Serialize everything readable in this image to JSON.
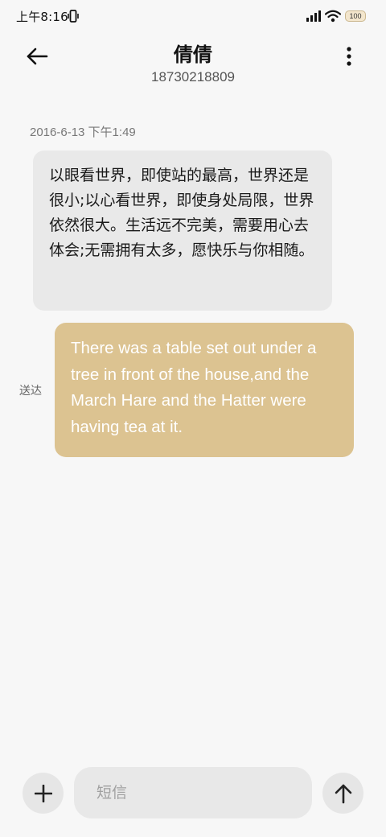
{
  "status_bar": {
    "time": "上午8:16",
    "battery": "100",
    "icons": [
      "vibrate-icon",
      "signal-icon",
      "wifi-icon",
      "battery-icon"
    ]
  },
  "header": {
    "back_icon": "arrow-left-icon",
    "contact_name": "倩倩",
    "contact_number": "18730218809",
    "more_icon": "more-vertical-icon"
  },
  "conversation": {
    "timestamp": "2016-6-13 下午1:49",
    "messages": [
      {
        "direction": "received",
        "text": "以眼看世界，即使站的最高，世界还是很小;以心看世界，即使身处局限，世界依然很大。生活远不完美，需要用心去体会;无需拥有太多，愿快乐与你相随。"
      },
      {
        "direction": "sent",
        "status": "送达",
        "text": "There was a table set out under a tree in front of the house,and the March Hare and the Hatter were having tea at it."
      }
    ]
  },
  "composer": {
    "attach_icon": "plus-icon",
    "placeholder": "短信",
    "send_icon": "arrow-up-icon"
  },
  "colors": {
    "background": "#f7f7f7",
    "received_bubble": "#e9e9e9",
    "sent_bubble": "#dcc391",
    "sent_text": "#ffffff"
  }
}
